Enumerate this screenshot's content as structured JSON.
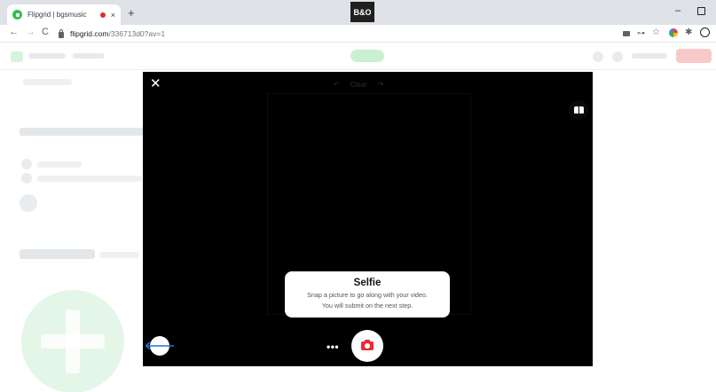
{
  "browser": {
    "tab": {
      "title": "Flipgrid | bgsmusic",
      "close_glyph": "×"
    },
    "new_tab_glyph": "+",
    "extension_badge": "B&O",
    "window": {
      "minimize_glyph": "–"
    },
    "nav": {
      "back": "←",
      "forward": "→",
      "reload": "C"
    },
    "address": {
      "host": "flipgrid.com",
      "path": "/336713d0?av=1"
    },
    "toolbar": {
      "key_glyph": "⊶",
      "star_glyph": "☆",
      "puzzle_glyph": "✱"
    }
  },
  "recorder": {
    "close_glyph": "✕",
    "toolbar": {
      "undo": "↶",
      "clear": "Clear",
      "redo": "↷"
    },
    "selfie": {
      "title": "Selfie",
      "line1": "Snap a picture to go along with your video.",
      "line2": "You will submit on the next step."
    },
    "back_glyph": "🡐",
    "more_glyph": "•••"
  },
  "colors": {
    "accent_green": "#31c24b",
    "capture_red": "#ec2a39",
    "back_blue": "#1f71e0",
    "modal_bg": "#000000"
  }
}
